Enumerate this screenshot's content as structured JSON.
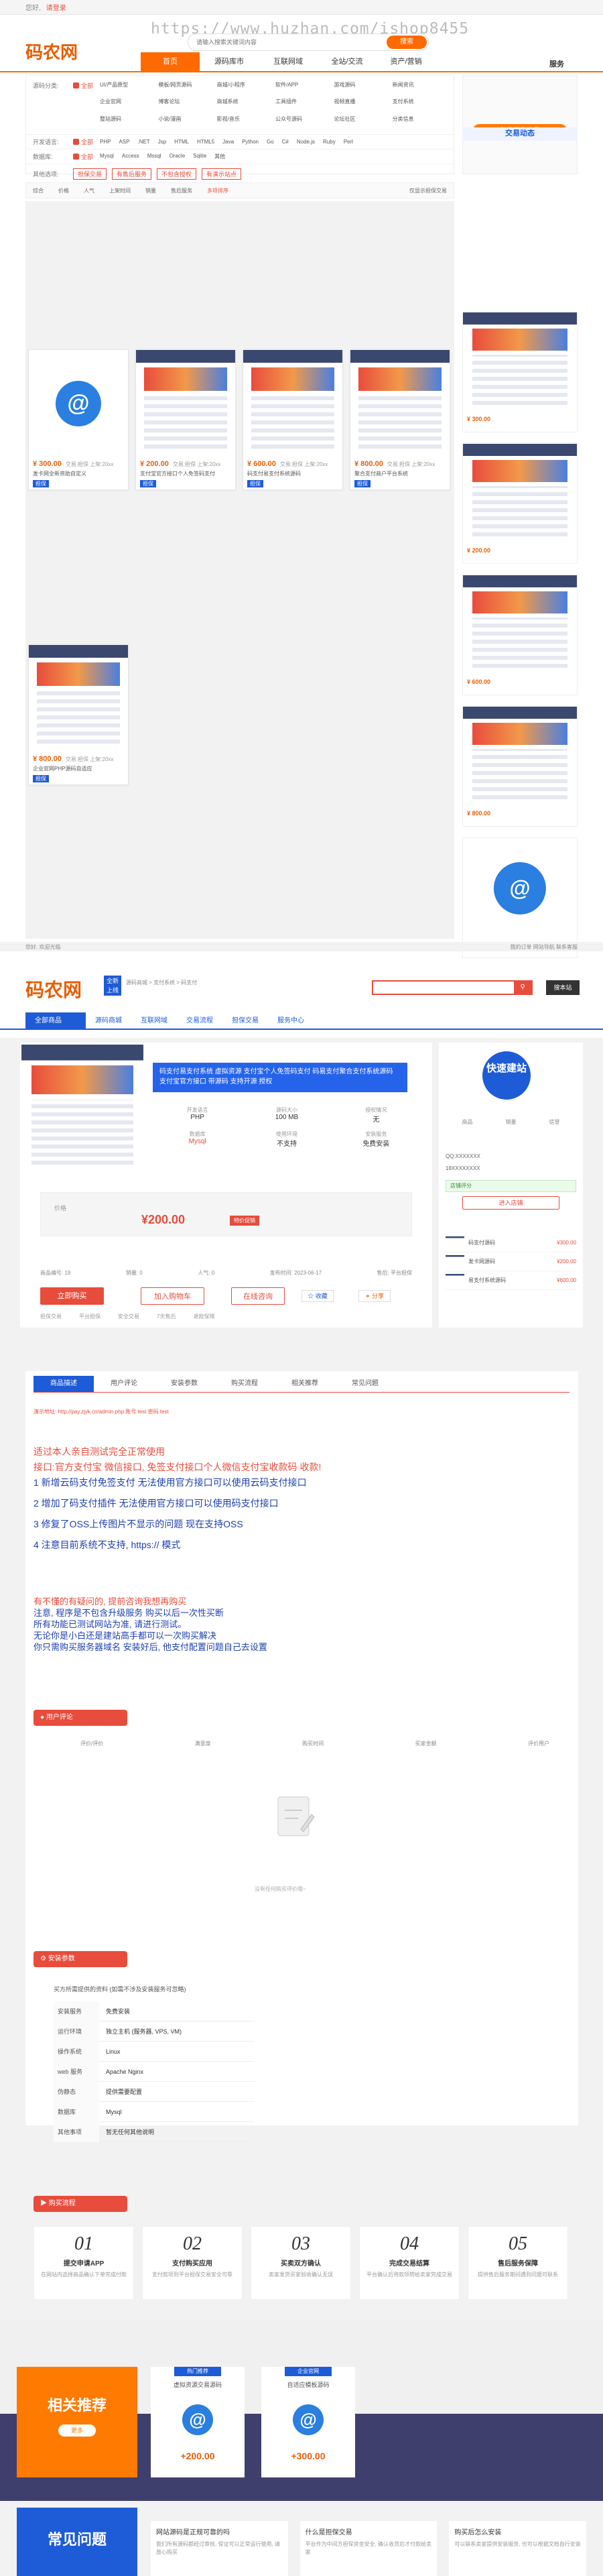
{
  "topbar": {
    "greeting": "您好,",
    "login": "请登录",
    "watermark": "https://www.huzhan.com/ishop8455"
  },
  "header": {
    "logo": "码农网",
    "search_placeholder": "请输入搜索关键词内容",
    "search_button": "搜索",
    "service": "服务"
  },
  "nav": {
    "items": [
      "首页",
      "源码库市",
      "互联网域",
      "全站/交流",
      "资产/营销"
    ],
    "right": "服务"
  },
  "filters": {
    "row1": {
      "label": "源码分类:",
      "all": "全部",
      "items": [
        "UI/产品原型",
        "模板/网页源码",
        "商城/小程序",
        "软件/APP",
        "游戏源码",
        "新闻资讯",
        "企业官网",
        "博客论坛",
        "商城系统",
        "工具插件",
        "视频直播",
        "支付系统",
        "整站源码",
        "小说/漫画",
        "影视/音乐",
        "公众号源码",
        "论坛社区",
        "分类信息"
      ]
    },
    "row2": {
      "label": "开发语言:",
      "all": "全部",
      "items": [
        "PHP",
        "ASP",
        ".NET",
        "Jsp",
        "HTML",
        "HTML5",
        "Java",
        "Python",
        "Go",
        "C#",
        "Node.js",
        "Ruby",
        "Perl"
      ]
    },
    "row3": {
      "label": "数据库:",
      "all": "全部",
      "items": [
        "Mysql",
        "Access",
        "Mssql",
        "Oracle",
        "Sqlite",
        "其他"
      ]
    },
    "row4": {
      "label": "其他选项:",
      "items": [
        "担保交易",
        "有售后服务",
        "不包含授权",
        "有演示站点"
      ]
    },
    "side_btn": "免费发布商品"
  },
  "sort": {
    "items": [
      "综合",
      "价格",
      "人气",
      "上架时间",
      "销量",
      "售后服务",
      "多项排序"
    ],
    "right": "仅显示担保交易"
  },
  "products": [
    {
      "price": "¥ 300.00",
      "title": "发卡网全新资助自定义",
      "desc": "交易:担保 上架:20xx",
      "tag": "担保"
    },
    {
      "price": "¥ 200.00",
      "title": "支付宝官方接口个人免签码支付",
      "desc": "交易:担保 上架:20xx",
      "tag": "担保"
    },
    {
      "price": "¥ 600.00",
      "title": "码支付易支付系统源码",
      "desc": "交易:担保 上架:20xx",
      "tag": "担保"
    },
    {
      "price": "¥ 800.00",
      "title": "聚合支付商户平台系统",
      "desc": "交易:担保 上架:20xx",
      "tag": "担保"
    },
    {
      "price": "¥ 800.00",
      "title": "企业官网PHP源码自适应",
      "desc": "交易:担保 上架:20xx",
      "tag": "担保"
    }
  ],
  "side_list": {
    "title": "交易动态",
    "prices": [
      "¥ 300.00",
      "¥ 200.00",
      "¥ 600.00",
      "¥ 800.00",
      "¥ 800.00"
    ]
  },
  "footer_mid": {
    "left": "您好, 欢迎光临",
    "right": "我的订单 网站导航 联系客服"
  },
  "detail": {
    "logo": "码农网",
    "badge": "全新\n上线",
    "breadcrumb": "源码商城 > 支付系统 > 码支付",
    "search_btn": "搜本站",
    "nav": [
      "全部商品",
      "源码商城",
      "互联网域",
      "交易流程",
      "担保交易",
      "服务中心"
    ],
    "product_title": "码支付易支付系统 虚拟资源 支付宝个人免签码支付 码易支付聚合支付系统源码 支付宝官方接口 带源码 支持开源 授权",
    "specs": [
      {
        "k": "开发语言",
        "v": "PHP"
      },
      {
        "k": "源码大小",
        "v": "100 MB"
      },
      {
        "k": "授权情况",
        "v": "无"
      },
      {
        "k": "数据库",
        "v": "Mysql"
      },
      {
        "k": "使用环境",
        "v": "不支持"
      },
      {
        "k": "安装服务",
        "v": "免费安装"
      }
    ],
    "price_label": "价格",
    "price": "¥200.00",
    "price_tag": "特价促销",
    "meta": [
      "商品编号: 19",
      "销量: 0",
      "人气: 0",
      "发布时间: 2023-06-17",
      "售后: 平台担保"
    ],
    "buttons": {
      "buy": "立即购买",
      "cart": "加入购物车",
      "chat": "在线咨询",
      "favorite": "收藏",
      "share": "分享"
    },
    "services": [
      "担保交易",
      "平台担保",
      "安全交易",
      "7天售后",
      "退款保障"
    ]
  },
  "shop": {
    "name": "快速建站",
    "stats": [
      "商品",
      "销量",
      "信誉"
    ],
    "contact_qq": "QQ:XXXXXXX",
    "contact_phone": "18XXXXXXXX",
    "score": "店铺评分",
    "shop_btn": "进入店铺",
    "recs": [
      {
        "t": "码支付源码",
        "p": "¥300.00"
      },
      {
        "t": "发卡网源码",
        "p": "¥200.00"
      },
      {
        "t": "易支付系统源码",
        "p": "¥600.00"
      }
    ]
  },
  "tabs": [
    "商品描述",
    "用户评论",
    "安装参数",
    "购买流程",
    "相关推荐",
    "常见问题"
  ],
  "desc": {
    "url": "演示地址: http://pay.zjyk.cn/admin.php 账号 test 密码 test",
    "lines": [
      {
        "c": "red",
        "t": "适过本人亲自测试完全正常使用"
      },
      {
        "c": "red",
        "t": "接口:官方支付宝 微信接口, 免签支付接口个人微信支付宝收款码 收款!"
      },
      {
        "c": "blue",
        "t": "1  新增云码支付免签支付  无法使用官方接口可以使用云码支付接口"
      },
      {
        "c": "blue",
        "t": "2  增加了码支付插件  无法使用官方接口可以使用码支付接口"
      },
      {
        "c": "blue",
        "t": "3  修复了OSS上传图片不显示的问题 现在支持OSS"
      },
      {
        "c": "blue",
        "t": "4 注意目前系统不支持, https:// 模式"
      }
    ],
    "notes": [
      "有不懂的有疑问的, 提前咨询我想再购买",
      "注意, 程序是不包含升级服务 购买以后一次性买断",
      "所有功能已测试网站为准, 请进行测试。",
      "无论你是小白还是建站高手都可以一次购买解决",
      "你只需购买服务器域名 安装好后, 他支付配置问题自己去设置"
    ]
  },
  "reviews": {
    "head": "用户评论",
    "cols": [
      "评价/评价",
      "满意度",
      "购买时间",
      "买家金额",
      "评价用户"
    ],
    "empty": "没有任何购买评价哦~"
  },
  "params": {
    "head": "安装参数",
    "note": "买方所需提供的资料 (如需不涉及安装服务可忽略)",
    "rows": [
      {
        "k": "安装服务",
        "v": "免费安装"
      },
      {
        "k": "运行环境",
        "v": "独立主机 (服务器, VPS, VM)"
      },
      {
        "k": "操作系统",
        "v": "Linux"
      },
      {
        "k": "web 服务",
        "v": "Apache Nginx"
      },
      {
        "k": "伪静态",
        "v": "提供需要配置"
      },
      {
        "k": "数据库",
        "v": "Mysql"
      },
      {
        "k": "其他事项",
        "v": "暂无任何其他说明"
      }
    ]
  },
  "process": {
    "head": "购买流程",
    "steps": [
      {
        "n": "01",
        "t": "提交申请APP",
        "d": "在网站内选择商品确认下单完成付款"
      },
      {
        "n": "02",
        "t": "支付购买应用",
        "d": "支付款项到平台担保交易安全可靠"
      },
      {
        "n": "03",
        "t": "买卖双方确认",
        "d": "卖家发货买家验收确认无误"
      },
      {
        "n": "04",
        "t": "完成交易结算",
        "d": "平台确认后将款项转给卖家完成交易"
      },
      {
        "n": "05",
        "t": "售后服务保障",
        "d": "提供售后服务期间遇到问题可联系"
      }
    ]
  },
  "recommend": {
    "title": "相关推荐",
    "btn": "更多",
    "items": [
      {
        "badge": "热门推荐",
        "t": "虚拟资源交易源码",
        "p": "+200.00"
      },
      {
        "badge": "企业官网",
        "t": "自适应模板源码",
        "p": "+300.00"
      }
    ]
  },
  "faq": {
    "title": "常见问题",
    "items": [
      {
        "q": "网站源码是正规可靠的吗",
        "a": "我们所有源码都经过审核, 保证可以正常运行使用, 请放心购买"
      },
      {
        "q": "什么是担保交易",
        "a": "平台作为中间方担保资金安全, 确认收货后才付款给卖家"
      },
      {
        "q": "购买后怎么安装",
        "a": "可以联系卖家提供安装服务, 也可以根据文档自行安装"
      }
    ]
  }
}
